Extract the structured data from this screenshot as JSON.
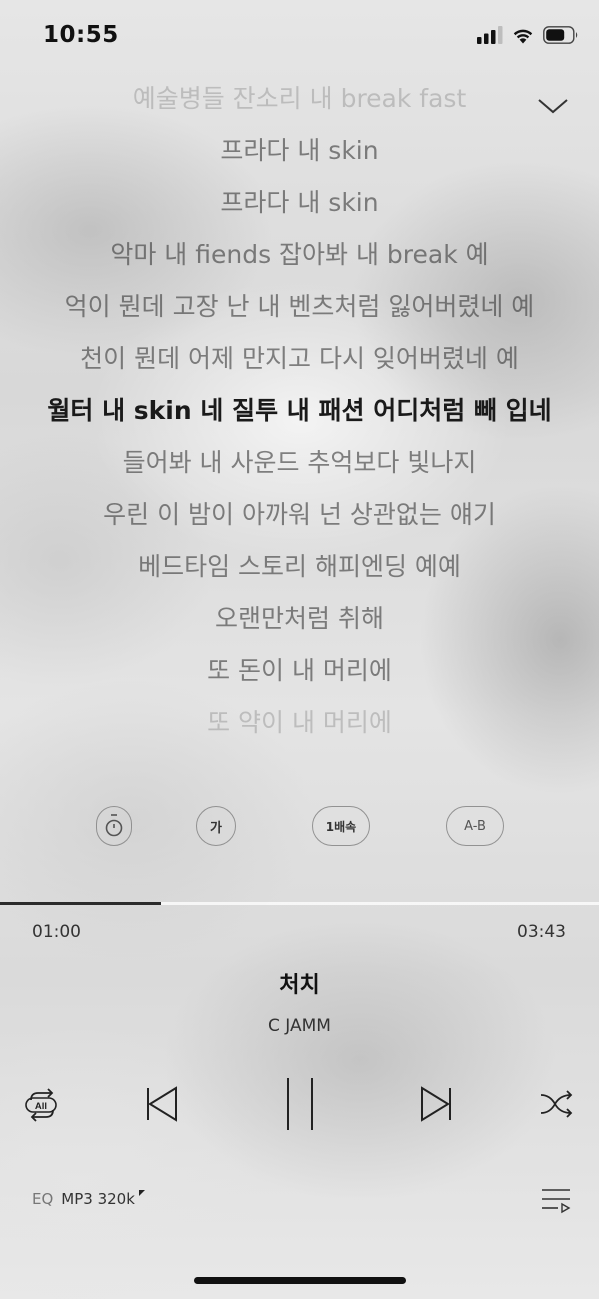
{
  "status_bar": {
    "time": "10:55",
    "icons": [
      "signal-icon",
      "wifi-icon",
      "battery-icon"
    ]
  },
  "header": {
    "collapse_icon": "chevron-down-icon"
  },
  "lyrics": {
    "current_index": 6,
    "lines": [
      "예술병들 잔소리 내 break fast",
      "프라다 내 skin",
      "프라다 내 skin",
      "악마 내 fiends 잡아봐 내 break 예",
      "억이 뭔데 고장 난 내 벤츠처럼 잃어버렸네 예",
      "천이 뭔데 어제 만지고 다시 잊어버렸네 예",
      "월터 내 skin 네 질투 내 패션 어디처럼 빼 입네",
      "들어봐 내 사운드 추억보다 빛나지",
      "우린 이 밤이 아까워 넌 상관없는 얘기",
      "베드타임 스토리 해피엔딩 예예",
      "오랜만처럼 취해",
      "또 돈이 내 머리에",
      "또 약이 내 머리에"
    ]
  },
  "options": {
    "timer_icon": "timer-icon",
    "font_label": "가",
    "speed_label": "1배속",
    "ab_label": "A-B"
  },
  "playback": {
    "elapsed": "01:00",
    "total": "03:43",
    "progress_fraction": 0.269
  },
  "track": {
    "title": "처치",
    "artist": "C JAMM"
  },
  "controls": {
    "repeat_label": "All",
    "icons": [
      "repeat-all-icon",
      "previous-icon",
      "pause-icon",
      "next-icon",
      "shuffle-icon"
    ]
  },
  "footer": {
    "eq_label": "EQ",
    "quality_label": "MP3 320k",
    "playlist_icon": "playlist-icon"
  },
  "colors": {
    "accent": "#1a1a1a",
    "progress": "#2b2b2b",
    "track": "#ffffff"
  }
}
